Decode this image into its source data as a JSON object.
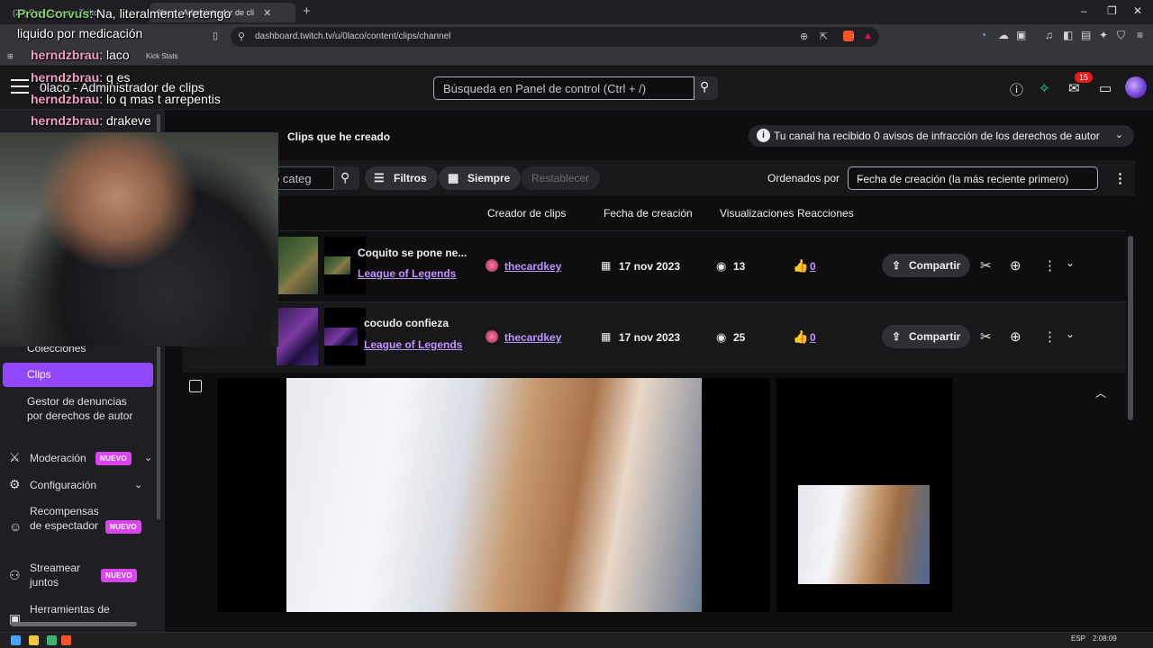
{
  "browser": {
    "tabs": [
      {
        "label": "(29) ProdCorvus - Twitch"
      },
      {
        "label": "0laco - Administrador de cli"
      }
    ],
    "url": "dashboard.twitch.tv/u/0laco/content/clips/channel",
    "bookmark": "Kick Stats"
  },
  "header": {
    "title": "0laco - Administrador de clips",
    "search_placeholder": "Búsqueda en Panel de control (Ctrl + /)",
    "notifications_count": "15"
  },
  "sidebar": {
    "items": [
      {
        "label": "Colecciones"
      },
      {
        "label": "Clips"
      },
      {
        "label": "Gestor de denuncias por derechos de autor"
      },
      {
        "label": "Moderación",
        "badge": "NUEVO"
      },
      {
        "label": "Configuración"
      },
      {
        "label": "Recompensas de espectador",
        "badge": "NUEVO"
      },
      {
        "label": "Streamear juntos",
        "badge": "NUEVO"
      },
      {
        "label": "Herramientas de"
      }
    ]
  },
  "main": {
    "section_title": "Clips que he creado",
    "copyright_notice": "Tu canal ha recibido 0 avisos de infracción de los derechos de autor",
    "filter_placeholder": "o categ",
    "buttons": {
      "filters": "Filtros",
      "time": "Siempre",
      "reset": "Restablecer"
    },
    "sort": {
      "label": "Ordenados por",
      "value": "Fecha de creación (la más reciente primero)"
    },
    "columns": [
      "Creador de clips",
      "Fecha de creación",
      "Visualizaciones",
      "Reacciones"
    ],
    "rows": [
      {
        "title": "Coquito se pone ne...",
        "game": "League of Legends",
        "creator": "thecardkey",
        "date": "17 nov 2023",
        "views": "13",
        "reactions": "0",
        "share": "Compartir"
      },
      {
        "title": "cocudo confieza",
        "game": "League of Legends",
        "creator": "thecardkey",
        "date": "17 nov 2023",
        "views": "25",
        "reactions": "0",
        "share": "Compartir"
      }
    ]
  },
  "chat": [
    {
      "user": "ProdCorvus",
      "message": "Na, literalmente retengo"
    },
    {
      "user": "",
      "message": "liquido por medicación"
    },
    {
      "user": "herndzbrau",
      "message": "laco"
    },
    {
      "user": "herndzbrau",
      "message": "q es"
    },
    {
      "user": "herndzbrau",
      "message": "lo q mas t arrepentis"
    },
    {
      "user": "herndzbrau",
      "message": "drakeve"
    }
  ],
  "taskbar": {
    "lang": "ESP",
    "time": "2:08:09"
  },
  "colors": {
    "accent": "#9147ff",
    "link": "#bf94ff",
    "badge_new": "#d946ef"
  }
}
